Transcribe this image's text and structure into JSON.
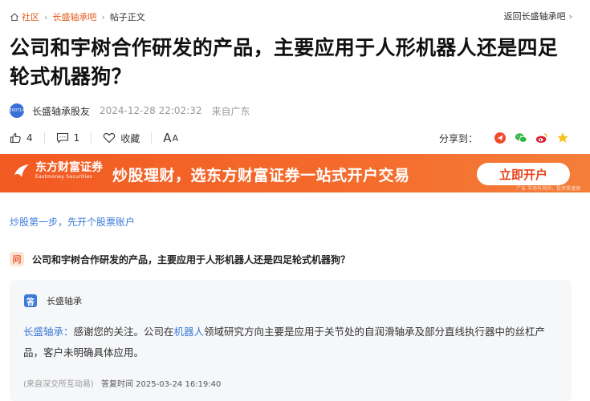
{
  "breadcrumb": {
    "home": "社区",
    "bar": "长盛轴承吧",
    "current": "帖子正文",
    "back": "返回长盛轴承吧"
  },
  "post": {
    "title": "公司和宇树合作研发的产品，主要应用于人形机器人还是四足轮式机器狗？",
    "author": "长盛轴承股友",
    "avatar_text": "300714",
    "time": "2024-12-28 22:02:32",
    "from": "来自广东"
  },
  "actions": {
    "likes": "4",
    "comments": "1",
    "favorite_label": "收藏",
    "font_big": "A",
    "font_small": "A",
    "share_label": "分享到："
  },
  "banner": {
    "logo_cn": "东方财富证券",
    "logo_en": "Eastmoney Securities",
    "slogan": "炒股理财，选东方财富证券一站式开户交易",
    "cta": "立即开户",
    "risk": "广告 市场有风险，投资需谨慎"
  },
  "promo_link": "炒股第一步，先开个股票账户",
  "qa": {
    "q_badge": "问",
    "question": "公司和宇树合作研发的产品，主要应用于人形机器人还是四足轮式机器狗？",
    "a_badge": "答",
    "company": "长盛轴承",
    "answer_prefix": "长盛轴承：",
    "answer_part1": "感谢您的关注。公司在",
    "answer_link": "机器人",
    "answer_part2": "领域研究方向主要是应用于关节处的自润滑轴承及部分直线执行器中的丝杠产品，客户未明确具体应用。",
    "source": "(来自深交所互动易)",
    "reply_time": "答复时间 2025-03-24 16:19:40"
  },
  "colors": {
    "accent": "#e85a1a",
    "link": "#3d7bd9",
    "banner": "#f15a22"
  },
  "icons": [
    "home-icon",
    "like-icon",
    "comment-icon",
    "heart-icon",
    "font-size-icon",
    "share-app-icon",
    "wechat-icon",
    "weibo-icon",
    "star-icon"
  ]
}
